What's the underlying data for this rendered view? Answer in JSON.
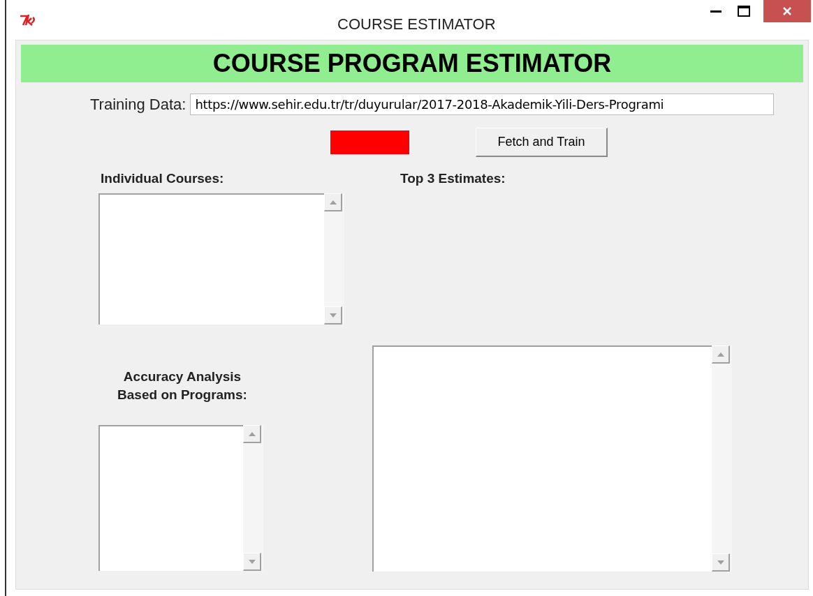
{
  "window": {
    "title": "COURSE ESTIMATOR"
  },
  "header": "COURSE PROGRAM ESTIMATOR",
  "training_data": {
    "label": "Training Data:",
    "value": "https://www.sehir.edu.tr/tr/duyurular/2017-2018-Akademik-Yili-Ders-Programi"
  },
  "status_indicator": {
    "color": "#ff0000"
  },
  "fetch_button": "Fetch and Train",
  "individual_courses": {
    "label": "Individual Courses:"
  },
  "top_estimates": {
    "label": "Top 3 Estimates:"
  },
  "accuracy_analysis": {
    "label": "Accuracy Analysis\nBased on Programs:"
  }
}
